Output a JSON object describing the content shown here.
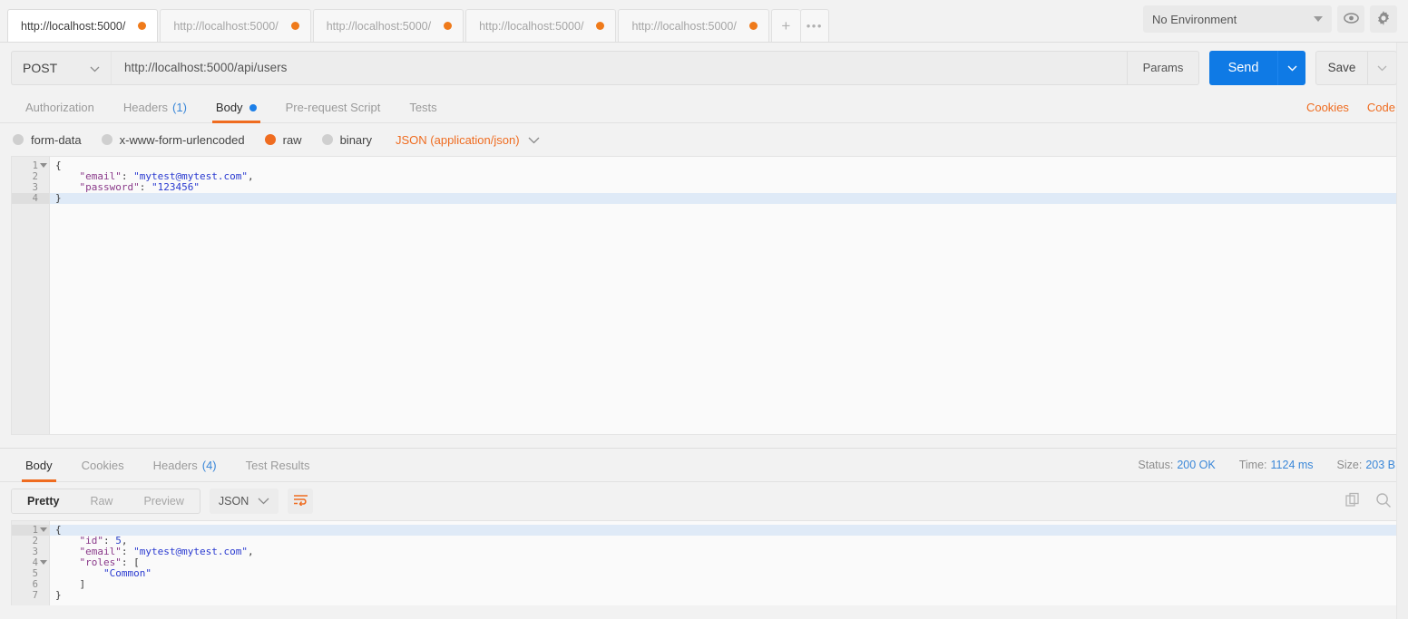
{
  "tabbar": {
    "tabs": [
      {
        "label": "http://localhost:5000/",
        "active": true
      },
      {
        "label": "http://localhost:5000/",
        "active": false
      },
      {
        "label": "http://localhost:5000/",
        "active": false
      },
      {
        "label": "http://localhost:5000/",
        "active": false
      },
      {
        "label": "http://localhost:5000/",
        "active": false
      }
    ],
    "new_tab_label": "+",
    "more_label": "•••",
    "environment": {
      "selected": "No Environment",
      "eye_icon": "eye-icon",
      "gear_icon": "gear-icon"
    }
  },
  "request": {
    "method": "POST",
    "url": "http://localhost:5000/api/users",
    "params_label": "Params",
    "send_label": "Send",
    "save_label": "Save",
    "tabs": [
      {
        "label": "Authorization",
        "active": false,
        "count": "",
        "dot": false
      },
      {
        "label": "Headers",
        "active": false,
        "count": "(1)",
        "dot": false
      },
      {
        "label": "Body",
        "active": true,
        "count": "",
        "dot": true
      },
      {
        "label": "Pre-request Script",
        "active": false,
        "count": "",
        "dot": false
      },
      {
        "label": "Tests",
        "active": false,
        "count": "",
        "dot": false
      }
    ],
    "cookies_label": "Cookies",
    "code_label": "Code",
    "body_types": [
      {
        "label": "form-data",
        "selected": false
      },
      {
        "label": "x-www-form-urlencoded",
        "selected": false
      },
      {
        "label": "raw",
        "selected": true
      },
      {
        "label": "binary",
        "selected": false
      }
    ],
    "content_type": "JSON (application/json)",
    "body_lines": [
      {
        "num": "1",
        "fold": true,
        "highlight": false,
        "text": "{"
      },
      {
        "num": "2",
        "fold": false,
        "highlight": false,
        "text": "    \"email\": \"mytest@mytest.com\","
      },
      {
        "num": "3",
        "fold": false,
        "highlight": false,
        "text": "    \"password\": \"123456\""
      },
      {
        "num": "4",
        "fold": false,
        "highlight": true,
        "text": "}"
      }
    ]
  },
  "response": {
    "tabs": [
      {
        "label": "Body",
        "active": true,
        "count": ""
      },
      {
        "label": "Cookies",
        "active": false,
        "count": ""
      },
      {
        "label": "Headers",
        "active": false,
        "count": "(4)"
      },
      {
        "label": "Test Results",
        "active": false,
        "count": ""
      }
    ],
    "status_label": "Status:",
    "status_value": "200 OK",
    "time_label": "Time:",
    "time_value": "1124 ms",
    "size_label": "Size:",
    "size_value": "203 B",
    "view_modes": [
      {
        "label": "Pretty",
        "active": true
      },
      {
        "label": "Raw",
        "active": false
      },
      {
        "label": "Preview",
        "active": false
      }
    ],
    "format": "JSON",
    "wrap_icon": "word-wrap-icon",
    "copy_icon": "copy-icon",
    "search_icon": "search-icon",
    "body_lines": [
      {
        "num": "1",
        "fold": true,
        "highlight": true,
        "text": "{"
      },
      {
        "num": "2",
        "fold": false,
        "highlight": false,
        "text": "    \"id\": 5,"
      },
      {
        "num": "3",
        "fold": false,
        "highlight": false,
        "text": "    \"email\": \"mytest@mytest.com\","
      },
      {
        "num": "4",
        "fold": true,
        "highlight": false,
        "text": "    \"roles\": ["
      },
      {
        "num": "5",
        "fold": false,
        "highlight": false,
        "text": "        \"Common\""
      },
      {
        "num": "6",
        "fold": false,
        "highlight": false,
        "text": "    ]"
      },
      {
        "num": "7",
        "fold": false,
        "highlight": false,
        "text": "}"
      }
    ]
  },
  "colors": {
    "accent_orange": "#ef6c20",
    "accent_blue": "#0f7ae5",
    "link_blue": "#3a87d8",
    "dot_orange": "#ef7a1a",
    "body_dot_blue": "#1c7fe8"
  }
}
